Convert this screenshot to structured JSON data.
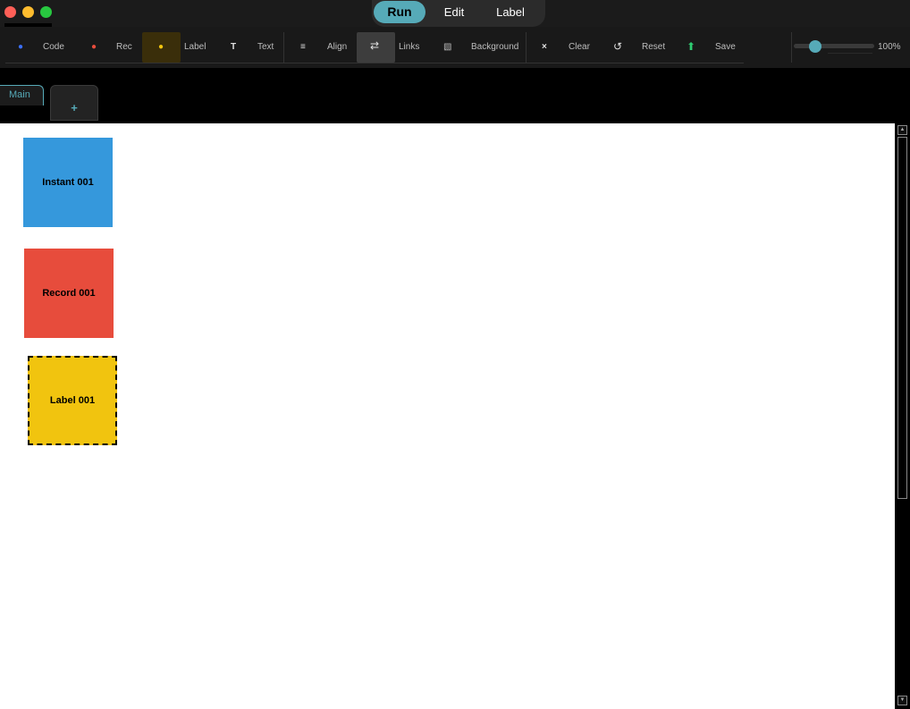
{
  "window": {
    "modes": [
      {
        "label": "Run",
        "active": true
      },
      {
        "label": "Edit",
        "active": false
      },
      {
        "label": "Label",
        "active": false
      }
    ]
  },
  "toolbar": {
    "tools": [
      {
        "label": "Code",
        "icon": "blue-dot-icon",
        "color": "#3b6fff"
      },
      {
        "label": "Rec",
        "icon": "red-dot-icon",
        "color": "#e74c3c"
      },
      {
        "label": "Label",
        "icon": "yellow-dot-icon",
        "color": "#f1c40f",
        "active": true
      },
      {
        "label": "Text",
        "icon": "text-icon",
        "glyph": "T"
      },
      {
        "label": "Align",
        "icon": "align-icon",
        "glyph": "≡"
      },
      {
        "label": "Links",
        "icon": "links-icon",
        "glyph": "⇄",
        "active": true
      },
      {
        "label": "Background",
        "icon": "background-icon",
        "glyph": "▧"
      },
      {
        "label": "Clear",
        "icon": "clear-icon",
        "glyph": "×"
      },
      {
        "label": "Reset",
        "icon": "reset-icon",
        "glyph": "↺"
      },
      {
        "label": "Save",
        "icon": "save-arrow-icon",
        "glyph": "⬆",
        "color": "#2ecc71"
      }
    ],
    "zoom": {
      "value": "100%",
      "level": 0.25
    }
  },
  "tabs": {
    "items": [
      {
        "label": "Main",
        "active": true
      }
    ],
    "add_label": "+"
  },
  "canvas": {
    "nodes": [
      {
        "label": "Instant 001",
        "type": "instant",
        "color": "#3598dc"
      },
      {
        "label": "Record 001",
        "type": "record",
        "color": "#e74c3c"
      },
      {
        "label": "Label 001",
        "type": "label",
        "color": "#f1c40f",
        "selected": true
      }
    ]
  }
}
